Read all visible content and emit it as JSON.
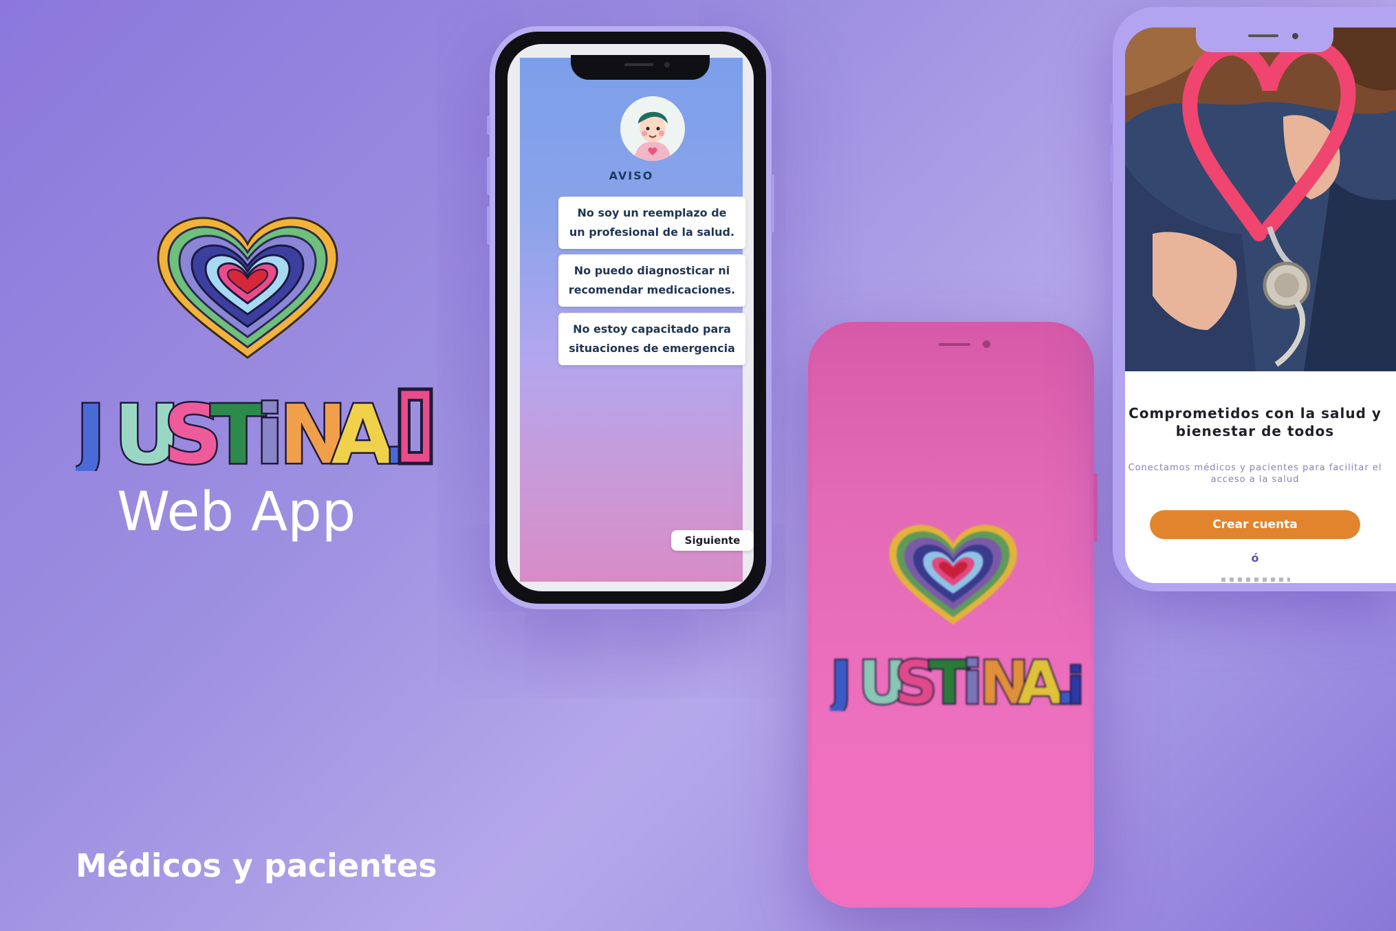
{
  "brand": {
    "wordmark": "JUSTiNA.iO",
    "subtitle": "Web App",
    "tagline": "Médicos y pacientes"
  },
  "phone_disclaimer": {
    "heading": "AVISO",
    "notices": [
      "No soy un reemplazo de un profesional de la salud.",
      "No puedo diagnosticar ni recomendar medicaciones.",
      "No estoy capacitado para situaciones de emergencia"
    ],
    "next_label": "Siguiente"
  },
  "phone_splash": {
    "wordmark": "JUSTiNA.iO"
  },
  "phone_signup": {
    "title": "Comprometidos con la salud y bienestar de todos",
    "subtitle": "Conectamos médicos y pacientes para facilitar el acceso a la salud",
    "create_account_label": "Crear cuenta",
    "or_label": "ó"
  },
  "colors": {
    "background": "#9d8fe0",
    "accent_orange": "#e2842e",
    "splash_pink": "#ec6dbd",
    "notice_text": "#1f3552"
  },
  "icons": [
    "heart-mandala-logo",
    "doctor-avatar",
    "stethoscope-heart-photo"
  ]
}
